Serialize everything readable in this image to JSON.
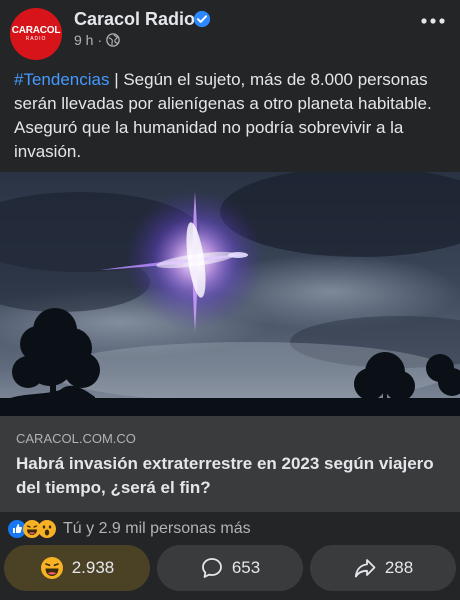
{
  "post": {
    "page_name": "Caracol Radio",
    "logo_text": "CARACOL",
    "logo_sub": "RADIO",
    "time": "9 h",
    "separator": "·",
    "privacy_icon": "globe-icon",
    "hashtag": "#Tendencias",
    "text": " | Según el sujeto, más de 8.000 personas serán llevadas por alienígenas a otro planeta habitable. Aseguró que la humanidad no podría sobrevivir a la invasión."
  },
  "link": {
    "domain": "CARACOL.COM.CO",
    "title": "Habrá invasión extraterrestre en 2023 según viajero del tiempo, ¿será el fin?"
  },
  "reactions": {
    "summary": "Tú y 2.9 mil personas más",
    "icons": [
      "like-icon",
      "haha-icon",
      "wow-icon"
    ]
  },
  "actions": {
    "react_count": "2.938",
    "comment_count": "653",
    "share_count": "288"
  },
  "colors": {
    "background": "#242526",
    "hashtag": "#4599ff",
    "verified": "#2d88ff",
    "brand_red": "#d7141a"
  }
}
